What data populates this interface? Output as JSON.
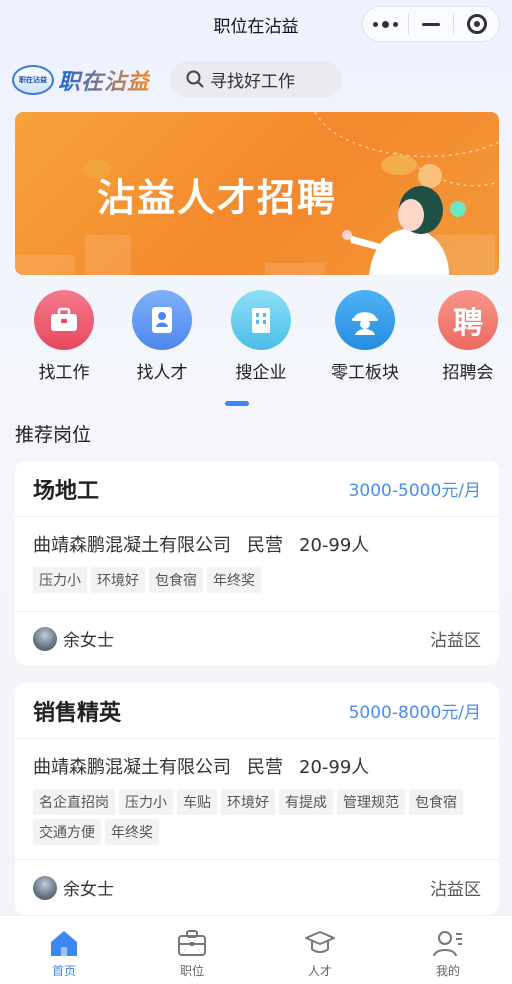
{
  "titlebar": {
    "title": "职位在沾益"
  },
  "header": {
    "logo_badge": "职在沾益",
    "logo_text": "职在沾益",
    "search_placeholder": "寻找好工作"
  },
  "banner": {
    "title": "沾益人才招聘"
  },
  "quicknav": [
    {
      "label": "找工作",
      "icon": "briefcase-icon",
      "color": "#ef5b72"
    },
    {
      "label": "找人才",
      "icon": "resume-icon",
      "color": "#5a94f2"
    },
    {
      "label": "搜企业",
      "icon": "building-icon",
      "color": "#5ec9ee"
    },
    {
      "label": "零工板块",
      "icon": "worker-helmet-icon",
      "color": "#3a9ee8"
    },
    {
      "label": "招聘会",
      "icon": "hire-char-icon",
      "glyph": "聘",
      "color": "#f0776c"
    }
  ],
  "section": {
    "recommended": "推荐岗位"
  },
  "jobs": [
    {
      "title": "场地工",
      "salary": "3000-5000元/月",
      "company": "曲靖森鹏混凝土有限公司",
      "ownership": "民营",
      "size": "20-99人",
      "tags": [
        "压力小",
        "环境好",
        "包食宿",
        "年终奖"
      ],
      "contact": "余女士",
      "area": "沾益区"
    },
    {
      "title": "销售精英",
      "salary": "5000-8000元/月",
      "company": "曲靖森鹏混凝土有限公司",
      "ownership": "民营",
      "size": "20-99人",
      "tags": [
        "名企直招岗",
        "压力小",
        "车贴",
        "环境好",
        "有提成",
        "管理规范",
        "包食宿",
        "交通方便",
        "年终奖"
      ],
      "contact": "余女士",
      "area": "沾益区"
    }
  ],
  "tabs": [
    {
      "label": "首页",
      "icon": "home-icon",
      "active": true
    },
    {
      "label": "职位",
      "icon": "briefcase-icon",
      "active": false
    },
    {
      "label": "人才",
      "icon": "graduation-cap-icon",
      "active": false
    },
    {
      "label": "我的",
      "icon": "user-icon",
      "active": false
    }
  ],
  "colors": {
    "accent": "#3d88f0",
    "salary": "#4a8ee8",
    "banner": "#f4882c"
  }
}
